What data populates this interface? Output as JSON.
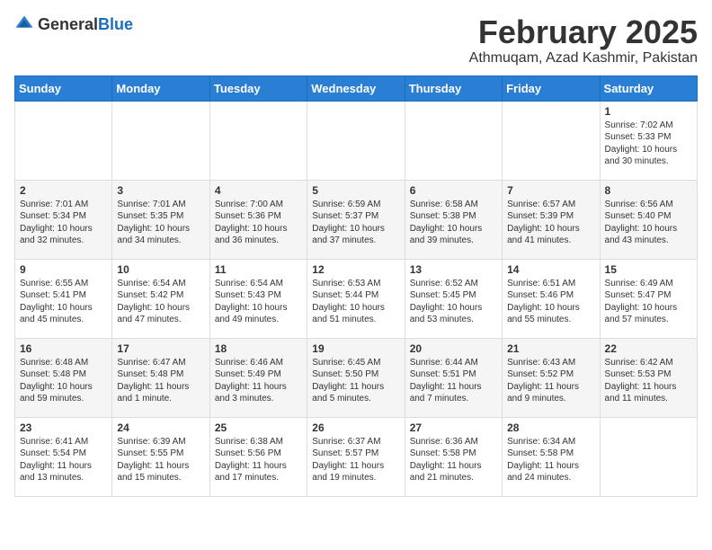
{
  "header": {
    "logo_general": "General",
    "logo_blue": "Blue",
    "month_title": "February 2025",
    "location": "Athmuqam, Azad Kashmir, Pakistan"
  },
  "weekdays": [
    "Sunday",
    "Monday",
    "Tuesday",
    "Wednesday",
    "Thursday",
    "Friday",
    "Saturday"
  ],
  "weeks": [
    [
      {
        "day": "",
        "info": ""
      },
      {
        "day": "",
        "info": ""
      },
      {
        "day": "",
        "info": ""
      },
      {
        "day": "",
        "info": ""
      },
      {
        "day": "",
        "info": ""
      },
      {
        "day": "",
        "info": ""
      },
      {
        "day": "1",
        "info": "Sunrise: 7:02 AM\nSunset: 5:33 PM\nDaylight: 10 hours\nand 30 minutes."
      }
    ],
    [
      {
        "day": "2",
        "info": "Sunrise: 7:01 AM\nSunset: 5:34 PM\nDaylight: 10 hours\nand 32 minutes."
      },
      {
        "day": "3",
        "info": "Sunrise: 7:01 AM\nSunset: 5:35 PM\nDaylight: 10 hours\nand 34 minutes."
      },
      {
        "day": "4",
        "info": "Sunrise: 7:00 AM\nSunset: 5:36 PM\nDaylight: 10 hours\nand 36 minutes."
      },
      {
        "day": "5",
        "info": "Sunrise: 6:59 AM\nSunset: 5:37 PM\nDaylight: 10 hours\nand 37 minutes."
      },
      {
        "day": "6",
        "info": "Sunrise: 6:58 AM\nSunset: 5:38 PM\nDaylight: 10 hours\nand 39 minutes."
      },
      {
        "day": "7",
        "info": "Sunrise: 6:57 AM\nSunset: 5:39 PM\nDaylight: 10 hours\nand 41 minutes."
      },
      {
        "day": "8",
        "info": "Sunrise: 6:56 AM\nSunset: 5:40 PM\nDaylight: 10 hours\nand 43 minutes."
      }
    ],
    [
      {
        "day": "9",
        "info": "Sunrise: 6:55 AM\nSunset: 5:41 PM\nDaylight: 10 hours\nand 45 minutes."
      },
      {
        "day": "10",
        "info": "Sunrise: 6:54 AM\nSunset: 5:42 PM\nDaylight: 10 hours\nand 47 minutes."
      },
      {
        "day": "11",
        "info": "Sunrise: 6:54 AM\nSunset: 5:43 PM\nDaylight: 10 hours\nand 49 minutes."
      },
      {
        "day": "12",
        "info": "Sunrise: 6:53 AM\nSunset: 5:44 PM\nDaylight: 10 hours\nand 51 minutes."
      },
      {
        "day": "13",
        "info": "Sunrise: 6:52 AM\nSunset: 5:45 PM\nDaylight: 10 hours\nand 53 minutes."
      },
      {
        "day": "14",
        "info": "Sunrise: 6:51 AM\nSunset: 5:46 PM\nDaylight: 10 hours\nand 55 minutes."
      },
      {
        "day": "15",
        "info": "Sunrise: 6:49 AM\nSunset: 5:47 PM\nDaylight: 10 hours\nand 57 minutes."
      }
    ],
    [
      {
        "day": "16",
        "info": "Sunrise: 6:48 AM\nSunset: 5:48 PM\nDaylight: 10 hours\nand 59 minutes."
      },
      {
        "day": "17",
        "info": "Sunrise: 6:47 AM\nSunset: 5:48 PM\nDaylight: 11 hours\nand 1 minute."
      },
      {
        "day": "18",
        "info": "Sunrise: 6:46 AM\nSunset: 5:49 PM\nDaylight: 11 hours\nand 3 minutes."
      },
      {
        "day": "19",
        "info": "Sunrise: 6:45 AM\nSunset: 5:50 PM\nDaylight: 11 hours\nand 5 minutes."
      },
      {
        "day": "20",
        "info": "Sunrise: 6:44 AM\nSunset: 5:51 PM\nDaylight: 11 hours\nand 7 minutes."
      },
      {
        "day": "21",
        "info": "Sunrise: 6:43 AM\nSunset: 5:52 PM\nDaylight: 11 hours\nand 9 minutes."
      },
      {
        "day": "22",
        "info": "Sunrise: 6:42 AM\nSunset: 5:53 PM\nDaylight: 11 hours\nand 11 minutes."
      }
    ],
    [
      {
        "day": "23",
        "info": "Sunrise: 6:41 AM\nSunset: 5:54 PM\nDaylight: 11 hours\nand 13 minutes."
      },
      {
        "day": "24",
        "info": "Sunrise: 6:39 AM\nSunset: 5:55 PM\nDaylight: 11 hours\nand 15 minutes."
      },
      {
        "day": "25",
        "info": "Sunrise: 6:38 AM\nSunset: 5:56 PM\nDaylight: 11 hours\nand 17 minutes."
      },
      {
        "day": "26",
        "info": "Sunrise: 6:37 AM\nSunset: 5:57 PM\nDaylight: 11 hours\nand 19 minutes."
      },
      {
        "day": "27",
        "info": "Sunrise: 6:36 AM\nSunset: 5:58 PM\nDaylight: 11 hours\nand 21 minutes."
      },
      {
        "day": "28",
        "info": "Sunrise: 6:34 AM\nSunset: 5:58 PM\nDaylight: 11 hours\nand 24 minutes."
      },
      {
        "day": "",
        "info": ""
      }
    ]
  ]
}
